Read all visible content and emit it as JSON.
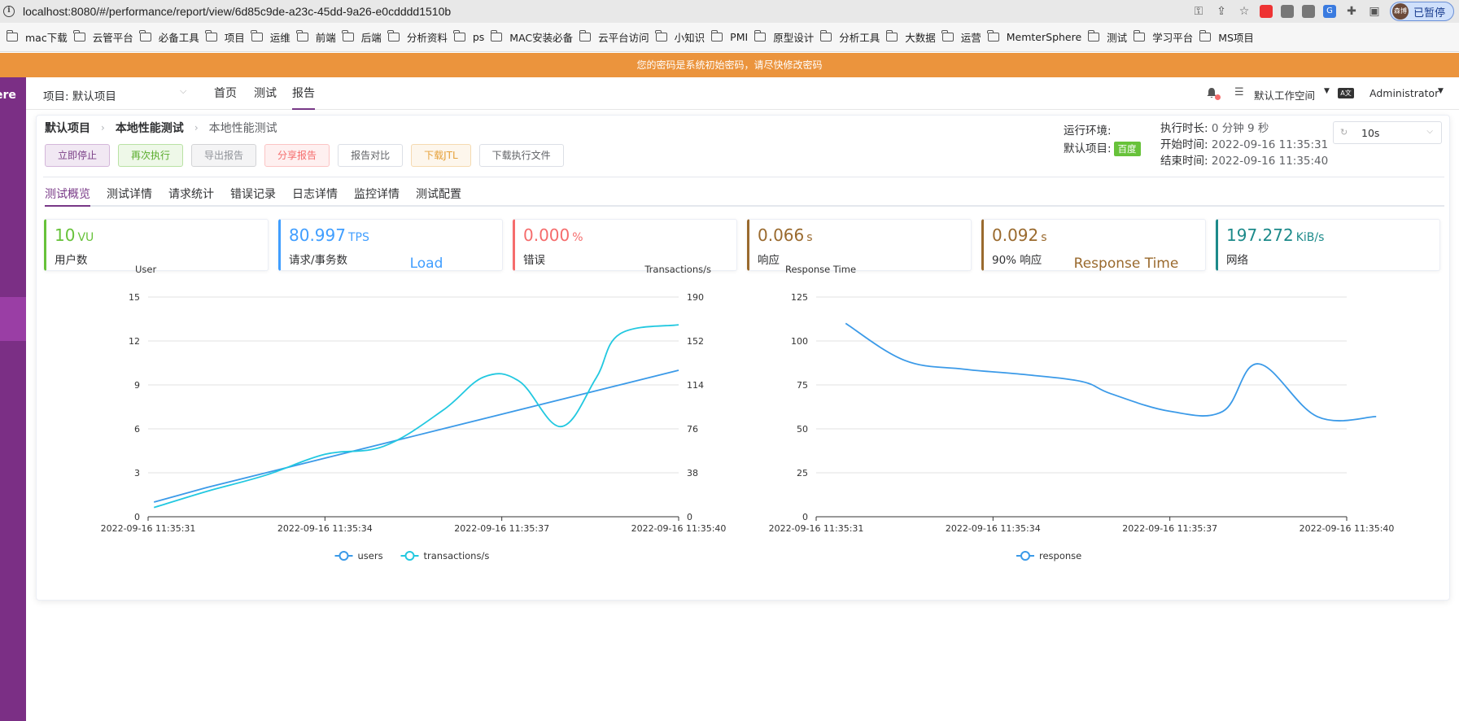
{
  "browser": {
    "url": "localhost:8080/#/performance/report/view/6d85c9de-a23c-45dd-9a26-e0cdddd1510b",
    "profile_label": "已暂停",
    "profile_avatar": "森博",
    "bookmarks": [
      "mac下载",
      "云管平台",
      "必备工具",
      "项目",
      "运维",
      "前端",
      "后端",
      "分析资料",
      "ps",
      "MAC安装必备",
      "云平台访问",
      "小知识",
      "PMI",
      "原型设计",
      "分析工具",
      "大数据",
      "运营",
      "MemterSphere",
      "测试",
      "学习平台",
      "MS项目"
    ]
  },
  "warning": "您的密码是系统初始密码，请尽快修改密码",
  "sidebar": {
    "logo_fragment": "ere"
  },
  "nav": {
    "project": "项目: 默认项目",
    "menu": [
      "首页",
      "测试",
      "报告"
    ],
    "active_menu": "报告",
    "workspace": "默认工作空间",
    "user": "Administrator"
  },
  "breadcrumb": [
    "默认项目",
    "本地性能测试",
    "本地性能测试"
  ],
  "actions": {
    "stop": "立即停止",
    "rerun": "再次执行",
    "export": "导出报告",
    "share": "分享报告",
    "compare": "报告对比",
    "download_jtl": "下载JTL",
    "download_files": "下载执行文件"
  },
  "env": {
    "label": "运行环境:",
    "project_label": "默认项目:",
    "env_tag": "百度"
  },
  "times": {
    "duration_label": "执行时长:",
    "duration": "0 分钟 9 秒",
    "start_label": "开始时间:",
    "start": "2022-09-16 11:35:31",
    "end_label": "结束时间:",
    "end": "2022-09-16 11:35:40"
  },
  "refresh": {
    "value": "10s"
  },
  "tabs": [
    "测试概览",
    "测试详情",
    "请求统计",
    "错误记录",
    "日志详情",
    "监控详情",
    "测试配置"
  ],
  "active_tab": "测试概览",
  "stats": [
    {
      "value": "10",
      "unit": "VU",
      "label": "用户数",
      "color": "#67c23a"
    },
    {
      "value": "80.997",
      "unit": "TPS",
      "label": "请求/事务数",
      "color": "#409eff"
    },
    {
      "value": "0.000",
      "unit": "%",
      "label": "错误",
      "color": "#f56c6c"
    },
    {
      "value": "0.066",
      "unit": "s",
      "label": "响应",
      "color": "#9a6a2e"
    },
    {
      "value": "0.092",
      "unit": "s",
      "label": "90% 响应",
      "color": "#9a6a2e"
    },
    {
      "value": "197.272",
      "unit": "KiB/s",
      "label": "网络",
      "color": "#1c8a8a"
    }
  ],
  "chart_data": [
    {
      "type": "line",
      "title": "Load",
      "title_color": "#409eff",
      "ylabel": "User",
      "y2label": "Transactions/s",
      "x_ticks": [
        "2022-09-16 11:35:31",
        "2022-09-16 11:35:34",
        "2022-09-16 11:35:37",
        "2022-09-16 11:35:40"
      ],
      "ylim": [
        0,
        15
      ],
      "y_ticks": [
        0,
        3,
        6,
        9,
        12,
        15
      ],
      "y2lim": [
        0,
        190
      ],
      "y2_ticks": [
        0,
        38,
        76,
        114,
        152,
        190
      ],
      "grid": true,
      "legend_position": "bottom",
      "series": [
        {
          "name": "users",
          "axis": "left",
          "color": "#3b9ae8",
          "x": [
            0.1,
            1.0,
            2.0,
            3.0,
            4.0,
            5.0,
            6.0,
            7.0,
            8.0,
            9.0
          ],
          "values": [
            1.0,
            2.0,
            3.0,
            4.0,
            5.0,
            6.0,
            7.0,
            8.0,
            9.0,
            10.0
          ]
        },
        {
          "name": "transactions/s",
          "axis": "right",
          "color": "#22c8e0",
          "x": [
            0.1,
            1.0,
            2.0,
            3.0,
            4.0,
            5.0,
            5.7,
            6.3,
            7.0,
            7.6,
            8.0,
            9.0
          ],
          "values": [
            8.0,
            22.0,
            36.0,
            54.0,
            61.0,
            92.0,
            121.0,
            117.0,
            78.0,
            120.0,
            158.0,
            166.0
          ]
        }
      ]
    },
    {
      "type": "line",
      "title": "Response Time",
      "title_color": "#9a6a2e",
      "ylabel": "Response Time",
      "x_ticks": [
        "2022-09-16 11:35:31",
        "2022-09-16 11:35:34",
        "2022-09-16 11:35:37",
        "2022-09-16 11:35:40"
      ],
      "ylim": [
        0,
        125
      ],
      "y_ticks": [
        0,
        25,
        50,
        75,
        100,
        125
      ],
      "grid": true,
      "legend_position": "bottom",
      "series": [
        {
          "name": "response",
          "color": "#3b9ae8",
          "x": [
            0.5,
            1.5,
            2.5,
            3.5,
            4.5,
            5.0,
            6.0,
            6.9,
            7.5,
            8.5,
            9.5
          ],
          "values": [
            110.0,
            89.0,
            84.0,
            81.0,
            77.0,
            70.0,
            60.0,
            60.0,
            87.0,
            57.0,
            57.0
          ]
        }
      ]
    }
  ]
}
